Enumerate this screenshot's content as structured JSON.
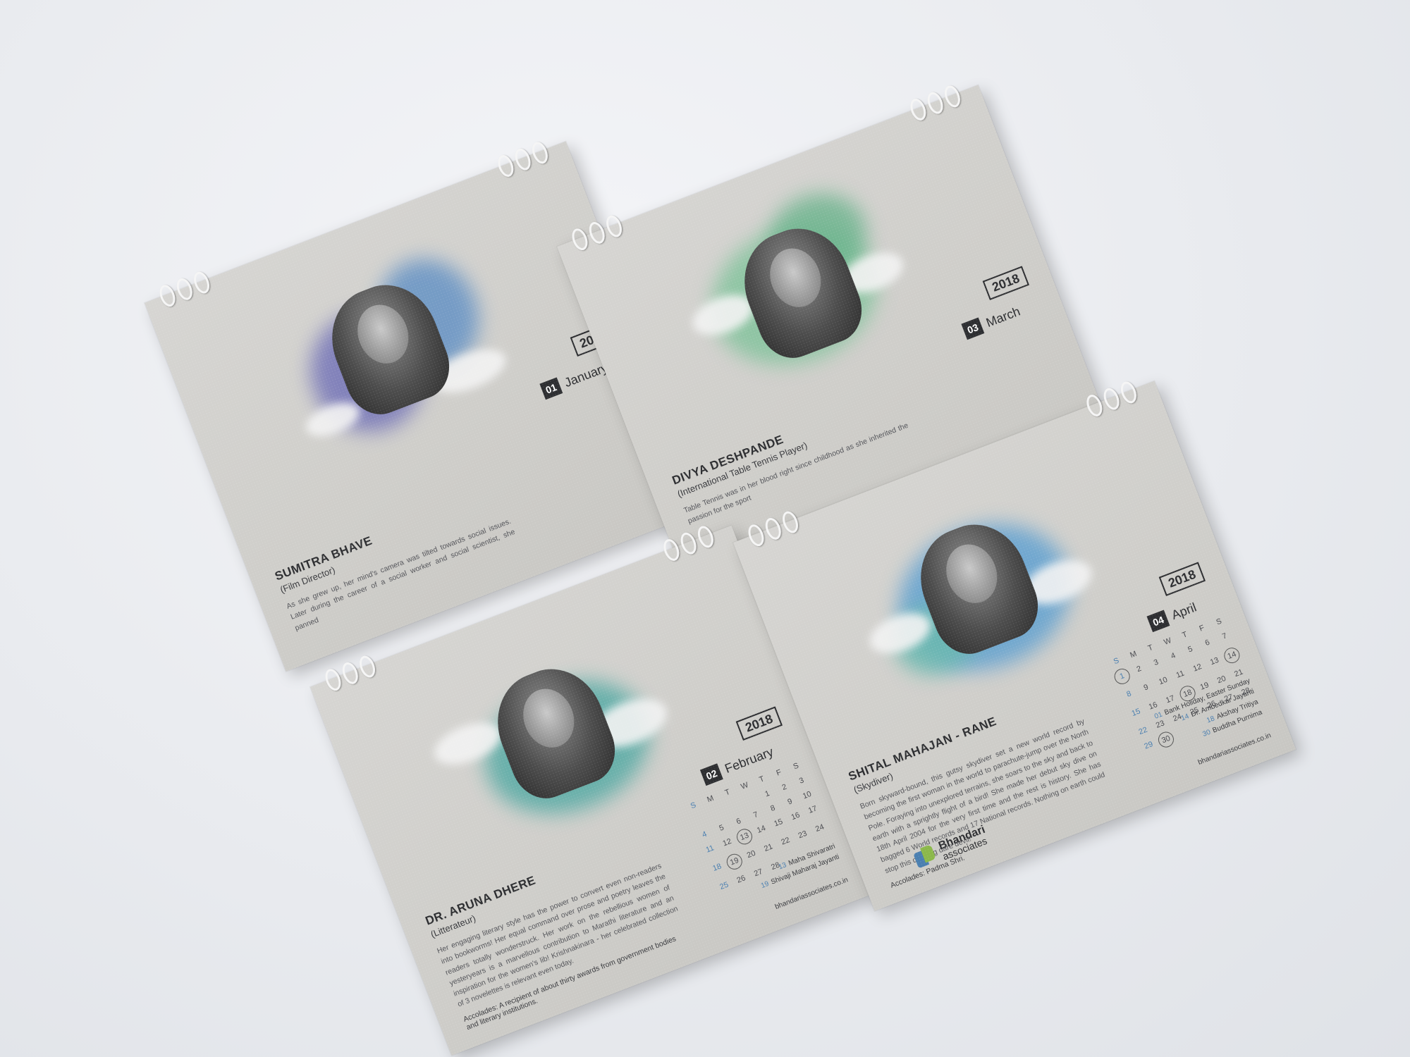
{
  "year": "2018",
  "weekday_headers": [
    "S",
    "M",
    "T",
    "W",
    "T",
    "F",
    "S"
  ],
  "cards": {
    "jan": {
      "month_num": "01",
      "month_name": "January",
      "name": "SUMITRA BHAVE",
      "role": "(Film Director)",
      "bio": "As she grew up, her mind's camera was tilted towards social issues. Later during the career of a social worker and social scientist, she panned"
    },
    "feb": {
      "month_num": "02",
      "month_name": "February",
      "name": "DR. ARUNA DHERE",
      "role": "(Litterateur)",
      "bio": "Her engaging literary style has the power to convert even non-readers into bookworms! Her equal command over prose and poetry leaves the readers totally wonderstruck. Her work on the rebellious women of yesteryears is a marvellous contribution to Marathi literature and an inspiration for the women's lib! Krishnakinara - her celebrated collection of 3 novelettes is relevant even today.",
      "accolades": "Accolades: A recipient of about thirty awards from government bodies and literary institutions.",
      "holidays": [
        {
          "d": "13",
          "t": "Maha Shivaratri"
        },
        {
          "d": "19",
          "t": "Shivaji Maharaj Jayanti"
        }
      ],
      "site": "bhandariassociates.co.in",
      "weeks": [
        [
          "",
          "",
          "",
          "",
          "1",
          "2",
          "3"
        ],
        [
          "4",
          "5",
          "6",
          "7",
          "8",
          "9",
          "10"
        ],
        [
          "11",
          "12",
          "13",
          "14",
          "15",
          "16",
          "17"
        ],
        [
          "18",
          "19",
          "20",
          "21",
          "22",
          "23",
          "24"
        ],
        [
          "25",
          "26",
          "27",
          "28",
          "",
          "",
          ""
        ]
      ]
    },
    "mar": {
      "month_num": "03",
      "month_name": "March",
      "name": "DIVYA DESHPANDE",
      "role": "(International Table Tennis Player)",
      "bio": "Table Tennis was in her blood right since childhood as she inherited the passion for the sport"
    },
    "apr": {
      "month_num": "04",
      "month_name": "April",
      "name": "SHITAL MAHAJAN - RANE",
      "role": "(Skydiver)",
      "bio": "Born skyward-bound, this gutsy skydiver set a new world record by becoming the first woman in the world to parachute-jump over the North Pole. Foraying into unexplored terrains, she soars to the sky and back to earth with a sprightly flight of a bird! She made her debut sky dive on 18th April 2004 for the very first time and the rest is history. She has bagged 6 World records and 17 National records. Nothing on earth could stop this dashing dare devil!",
      "accolades": "Accolades: Padma Shri.",
      "holidays": [
        {
          "d": "01",
          "t": "Bank Holiday, Easter Sunday"
        },
        {
          "d": "14",
          "t": "Dr. Ambedkar Jayanti"
        },
        {
          "d": "18",
          "t": "Akshay Tritiya"
        },
        {
          "d": "30",
          "t": "Buddha Purnima"
        }
      ],
      "site": "bhandariassociates.co.in",
      "logo_line1": "Bhandari",
      "logo_line2": "associates",
      "weeks": [
        [
          "1",
          "2",
          "3",
          "4",
          "5",
          "6",
          "7"
        ],
        [
          "8",
          "9",
          "10",
          "11",
          "12",
          "13",
          "14"
        ],
        [
          "15",
          "16",
          "17",
          "18",
          "19",
          "20",
          "21"
        ],
        [
          "22",
          "23",
          "24",
          "25",
          "26",
          "27",
          "28"
        ],
        [
          "29",
          "30",
          "",
          "",
          "",
          "",
          ""
        ]
      ]
    }
  },
  "palette": {
    "paper": "#cfceca",
    "ink": "#2d2e31",
    "accent_blue": "#4a7fb0",
    "accent_green": "#8bb84a"
  }
}
